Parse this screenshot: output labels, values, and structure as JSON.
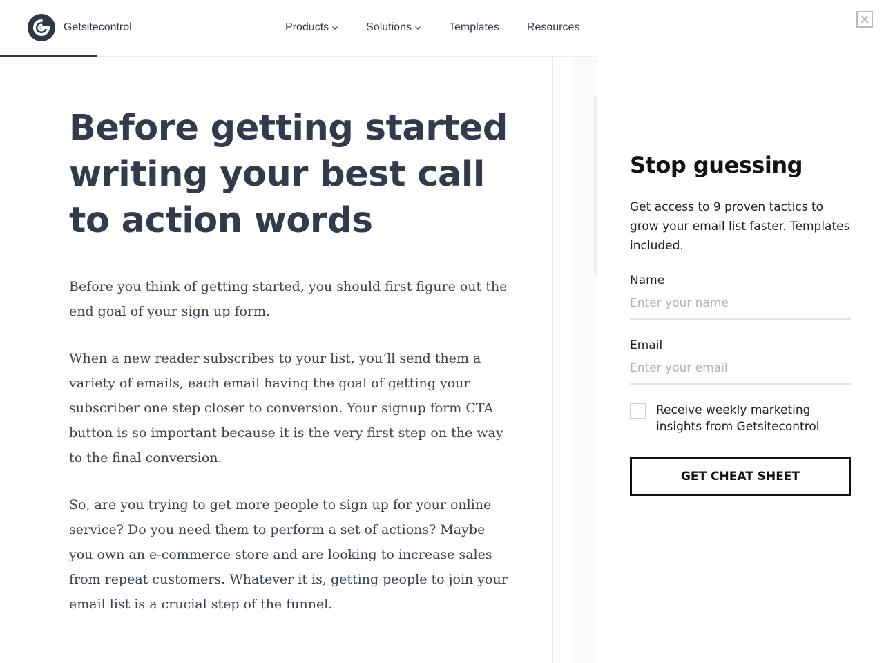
{
  "header": {
    "brand": "Getsitecontrol",
    "nav": [
      {
        "label": "Products",
        "has_dropdown": true
      },
      {
        "label": "Solutions",
        "has_dropdown": true
      },
      {
        "label": "Templates",
        "has_dropdown": false
      },
      {
        "label": "Resources",
        "has_dropdown": false
      }
    ],
    "reading_progress": 0.11
  },
  "article": {
    "title": "Before getting started writing your best call to action words",
    "paragraphs": [
      "Before you think of getting started, you should first figure out the end goal of your sign up form.",
      "When a new reader subscribes to your list, you’ll send them a variety of emails, each email having the goal of getting your subscriber one step closer to conversion. Your signup form CTA button is so important because it is the very first step on the way to the final conversion.",
      "So, are you trying to get more people to sign up for your online service? Do you need them to perform a set of actions? Maybe you own an e-commerce store and are looking to increase sales from repeat customers. Whatever it is, getting people to join your email list is a crucial step of the funnel."
    ]
  },
  "panel": {
    "title": "Stop guessing",
    "description": "Get access to 9 proven tactics to grow your email list faster. Templates included.",
    "name_label": "Name",
    "name_placeholder": "Enter your name",
    "email_label": "Email",
    "email_placeholder": "Enter your email",
    "consent": "Receive weekly marketing insights from Getsitecontrol",
    "cta": "GET CHEAT SHEET"
  },
  "colors": {
    "text_dark": "#2f3747",
    "accent_black": "#111111",
    "input_border": "#e3e3e6"
  }
}
